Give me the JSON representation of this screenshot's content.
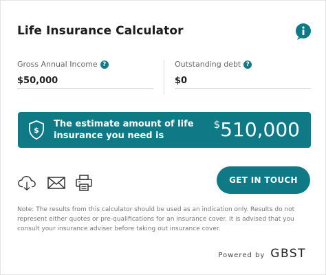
{
  "header": {
    "title": "Life Insurance Calculator",
    "info_icon": "info-icon"
  },
  "fields": {
    "income": {
      "label": "Gross Annual Income",
      "value": "$50,000",
      "help_icon": "question-icon",
      "help_glyph": "?"
    },
    "debt": {
      "label": "Outstanding debt",
      "value": "$0",
      "help_icon": "question-icon",
      "help_glyph": "?"
    }
  },
  "estimate": {
    "text": "The estimate amount of life insurance you need is",
    "currency": "$",
    "amount": "510,000",
    "icon": "shield-dollar-icon"
  },
  "actions": {
    "download_icon": "cloud-download-icon",
    "email_icon": "mail-icon",
    "print_icon": "printer-icon",
    "cta_label": "GET IN TOUCH"
  },
  "note": "Note: The results from this calculator should be used as an indication only. Results do not represent either quotes or pre-qualifications for an insurance cover. It is advised that you consult your insurance adviser before taking out insurance cover.",
  "footer": {
    "powered_by": "Powered by",
    "brand": "GBST"
  },
  "colors": {
    "accent": "#0f7a86",
    "text": "#222222",
    "muted": "#777777"
  }
}
